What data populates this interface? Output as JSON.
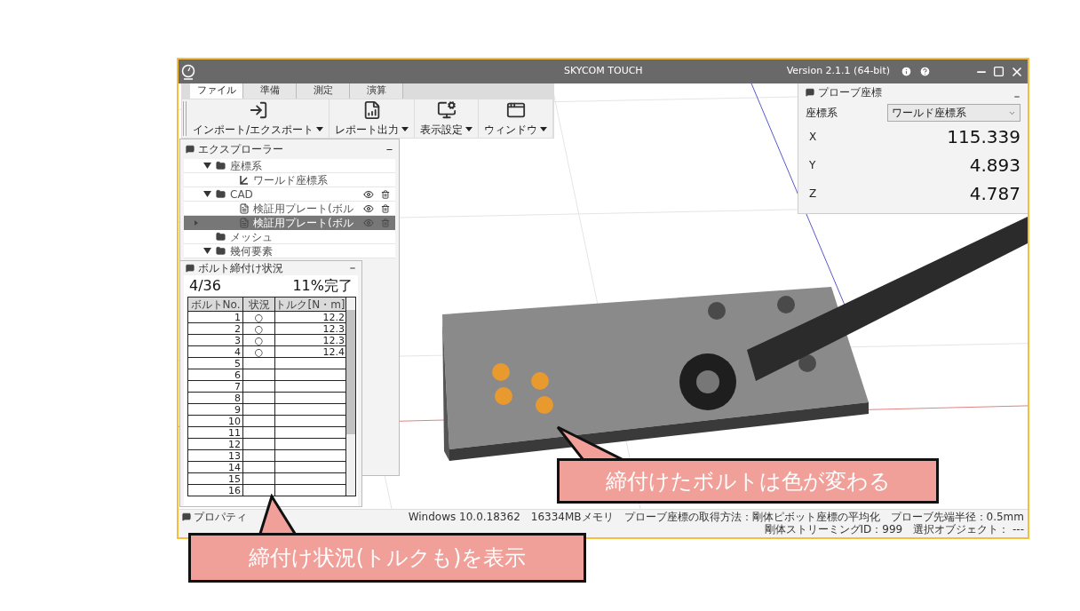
{
  "window": {
    "title": "SKYCOM TOUCH",
    "version": "Version 2.1.1 (64-bit)"
  },
  "ribbon": {
    "tabs": [
      {
        "label": "ファイル",
        "selected": true
      },
      {
        "label": "準備",
        "selected": false
      },
      {
        "label": "測定",
        "selected": false
      },
      {
        "label": "演算",
        "selected": false
      }
    ],
    "tools": [
      {
        "label": "インポート/エクスポート",
        "kind": "import"
      },
      {
        "label": "レポート出力",
        "kind": "report"
      },
      {
        "label": "表示設定",
        "kind": "display"
      },
      {
        "label": "ウィンドウ",
        "kind": "window"
      }
    ]
  },
  "explorer": {
    "title": "エクスプローラー",
    "tree": [
      {
        "label": "座標系",
        "kind": "folder",
        "expanded": true,
        "selected": false,
        "children": [
          {
            "label": "ワールド座標系",
            "kind": "axes",
            "selected": false
          }
        ]
      },
      {
        "label": "CAD",
        "kind": "folder",
        "expanded": true,
        "selected": false,
        "actions": true,
        "children": [
          {
            "label": "検証用プレート(ボル",
            "kind": "cad",
            "selected": false,
            "actions": true
          },
          {
            "label": "検証用プレート(ボル",
            "kind": "cad",
            "selected": true,
            "actions": true
          }
        ]
      },
      {
        "label": "メッシュ",
        "kind": "empty-folder",
        "selected": false
      },
      {
        "label": "幾何要素",
        "kind": "folder",
        "expanded": true,
        "selected": false
      }
    ]
  },
  "bolt_panel": {
    "title": "ボルト締付け状況",
    "count": "4/36",
    "progress": "11%完了",
    "columns": [
      "ボルトNo.",
      "状況",
      "トルク[N・m]"
    ],
    "rows": [
      [
        "1",
        "○",
        "12.2"
      ],
      [
        "2",
        "○",
        "12.3"
      ],
      [
        "3",
        "○",
        "12.3"
      ],
      [
        "4",
        "○",
        "12.4"
      ],
      [
        "5",
        "",
        ""
      ],
      [
        "6",
        "",
        ""
      ],
      [
        "7",
        "",
        ""
      ],
      [
        "8",
        "",
        ""
      ],
      [
        "9",
        "",
        ""
      ],
      [
        "10",
        "",
        ""
      ],
      [
        "11",
        "",
        ""
      ],
      [
        "12",
        "",
        ""
      ],
      [
        "13",
        "",
        ""
      ],
      [
        "14",
        "",
        ""
      ],
      [
        "15",
        "",
        ""
      ],
      [
        "16",
        "",
        ""
      ]
    ]
  },
  "probe_panel": {
    "title": "プローブ座標",
    "system_label": "座標系",
    "system_value": "ワールド座標系",
    "axes": [
      {
        "label": "X",
        "value": "115.339"
      },
      {
        "label": "Y",
        "value": "4.893"
      },
      {
        "label": "Z",
        "value": "4.787"
      }
    ]
  },
  "status_bar": {
    "tab": "プロパティ",
    "items": [
      "Windows 10.0.18362",
      "16334MBメモリ",
      "プローブ座標の取得方法：剛体ピボット座標の平均化",
      "プローブ先端半径：0.5mm",
      "剛体ストリーミングID：999",
      "選択オブジェクト： ---"
    ]
  },
  "callouts": [
    {
      "text": "締付けたボルトは色が変わる",
      "kind": "viewport"
    },
    {
      "text": "締付け状況(トルクも)を表示",
      "kind": "table"
    }
  ]
}
